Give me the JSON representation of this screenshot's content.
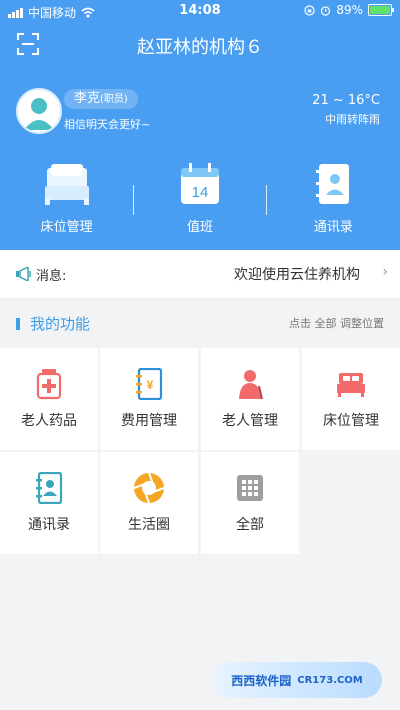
{
  "status_bar": {
    "carrier": "中国移动",
    "time": "14:08",
    "battery": "89%"
  },
  "header": {
    "title": "赵亚林的机构６"
  },
  "user": {
    "name": "李克",
    "role": "(职员)",
    "motto": "相信明天会更好~"
  },
  "weather": {
    "temp": "21 ~ 16°C",
    "condition": "中雨转阵雨"
  },
  "quick_actions": [
    {
      "label": "床位管理",
      "icon": "bed-icon"
    },
    {
      "label": "值班",
      "icon": "calendar-icon",
      "day": "14"
    },
    {
      "label": "通讯录",
      "icon": "contacts-icon"
    }
  ],
  "notice": {
    "label": "消息:",
    "text": "欢迎使用云住养机构"
  },
  "functions": {
    "title": "我的功能",
    "hint": "点击 全部 调整位置",
    "items": [
      {
        "label": "老人药品",
        "icon": "medicine-icon"
      },
      {
        "label": "费用管理",
        "icon": "fee-book-icon"
      },
      {
        "label": "老人管理",
        "icon": "elder-icon"
      },
      {
        "label": "床位管理",
        "icon": "bed-icon"
      },
      {
        "label": "通讯录",
        "icon": "contacts-icon"
      },
      {
        "label": "生活圈",
        "icon": "aperture-icon"
      },
      {
        "label": "全部",
        "icon": "grid-icon"
      }
    ]
  },
  "watermark": {
    "text": "西西软件园",
    "sub": "CR173.COM"
  },
  "colors": {
    "primary": "#4a9ef2",
    "accent": "#3d9ee8",
    "medicine": "#f26b6b",
    "orange": "#f5a623"
  }
}
